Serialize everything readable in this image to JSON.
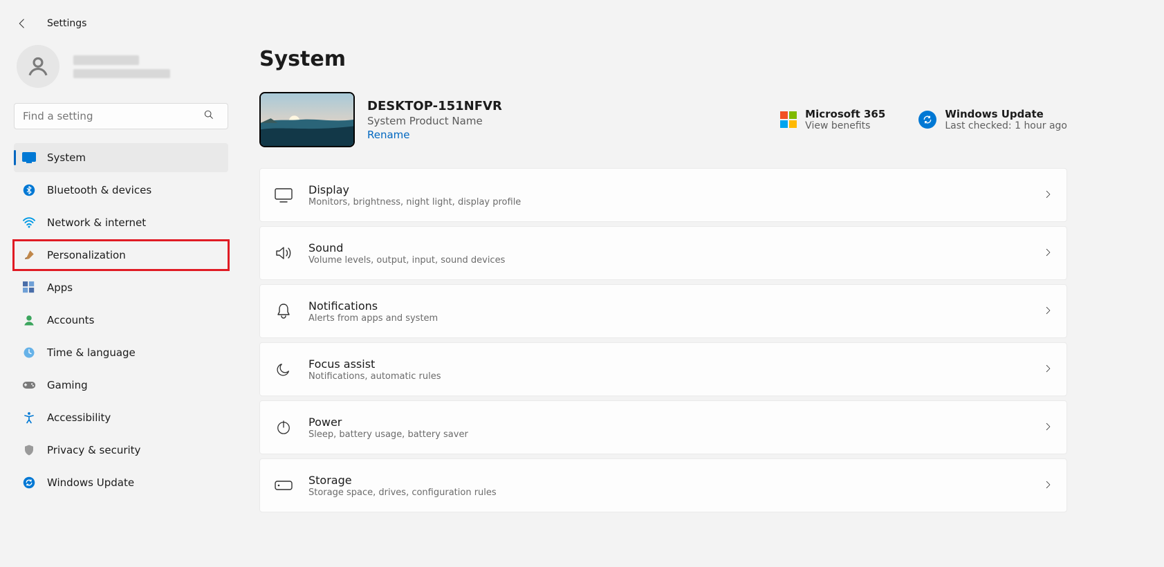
{
  "titlebar": {
    "title": "Settings"
  },
  "search": {
    "placeholder": "Find a setting"
  },
  "nav": {
    "system": "System",
    "bluetooth": "Bluetooth & devices",
    "network": "Network & internet",
    "personalization": "Personalization",
    "apps": "Apps",
    "accounts": "Accounts",
    "time": "Time & language",
    "gaming": "Gaming",
    "accessibility": "Accessibility",
    "privacy": "Privacy & security",
    "update": "Windows Update"
  },
  "page": {
    "title": "System"
  },
  "device": {
    "name": "DESKTOP-151NFVR",
    "product": "System Product Name",
    "rename": "Rename"
  },
  "shortcuts": {
    "ms365": {
      "title": "Microsoft 365",
      "sub": "View benefits"
    },
    "update": {
      "title": "Windows Update",
      "sub": "Last checked: 1 hour ago"
    }
  },
  "cards": {
    "display": {
      "title": "Display",
      "sub": "Monitors, brightness, night light, display profile"
    },
    "sound": {
      "title": "Sound",
      "sub": "Volume levels, output, input, sound devices"
    },
    "notifications": {
      "title": "Notifications",
      "sub": "Alerts from apps and system"
    },
    "focus": {
      "title": "Focus assist",
      "sub": "Notifications, automatic rules"
    },
    "power": {
      "title": "Power",
      "sub": "Sleep, battery usage, battery saver"
    },
    "storage": {
      "title": "Storage",
      "sub": "Storage space, drives, configuration rules"
    }
  }
}
